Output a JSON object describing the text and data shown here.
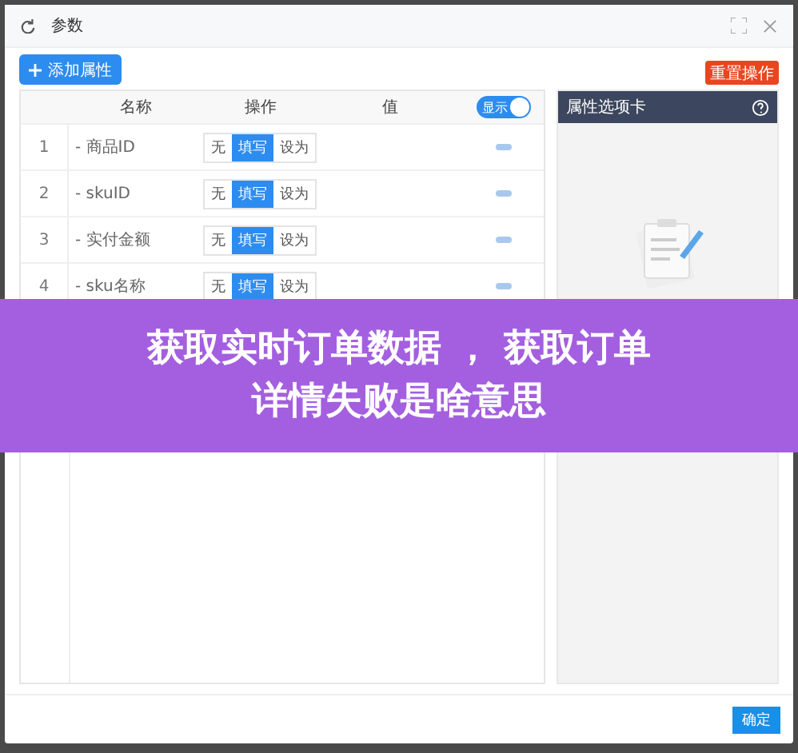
{
  "window": {
    "title": "参数"
  },
  "toolbar": {
    "add_button": "添加属性",
    "reset_button": "重置操作"
  },
  "table": {
    "columns": [
      "名称",
      "操作",
      "值"
    ],
    "display_toggle": {
      "label": "显示",
      "on": true
    },
    "rows": [
      {
        "index": "1",
        "name": "- 商品ID",
        "ops": [
          {
            "label": "无",
            "selected": false
          },
          {
            "label": "填写",
            "selected": true
          },
          {
            "label": "设为",
            "selected": false
          }
        ]
      },
      {
        "index": "2",
        "name": "- skuID",
        "ops": [
          {
            "label": "无",
            "selected": false
          },
          {
            "label": "填写",
            "selected": true
          },
          {
            "label": "设为",
            "selected": false
          }
        ]
      },
      {
        "index": "3",
        "name": "- 实付金额",
        "ops": [
          {
            "label": "无",
            "selected": false
          },
          {
            "label": "填写",
            "selected": true
          },
          {
            "label": "设为",
            "selected": false
          }
        ]
      },
      {
        "index": "4",
        "name": "- sku名称",
        "ops": [
          {
            "label": "无",
            "selected": false
          },
          {
            "label": "填写",
            "selected": true
          },
          {
            "label": "设为",
            "selected": false
          }
        ]
      }
    ]
  },
  "side_panel": {
    "title": "属性选项卡"
  },
  "footer": {
    "confirm_button": "确定"
  },
  "overlay_banner": {
    "lines": [
      "获取实时订单数据 ， 获取订单",
      "详情失败是啥意思"
    ]
  }
}
